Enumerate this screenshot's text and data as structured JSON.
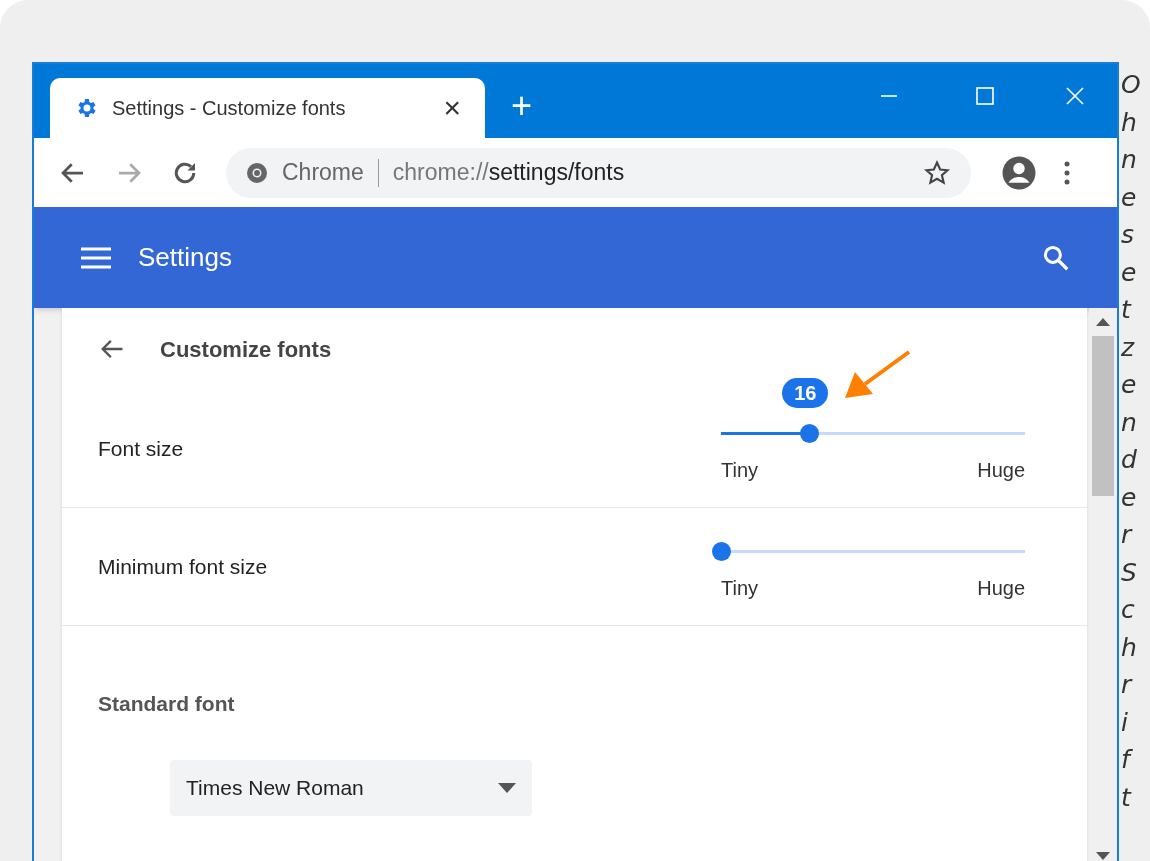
{
  "tab": {
    "title": "Settings - Customize fonts",
    "close": "×",
    "new_tab": "+"
  },
  "address_bar": {
    "origin": "Chrome",
    "url_scheme": "chrome://",
    "url_path": "settings/fonts"
  },
  "header": {
    "title": "Settings"
  },
  "page": {
    "title": "Customize fonts"
  },
  "sliders": [
    {
      "label": "Font size",
      "level": 0.29,
      "value_bubble": "16",
      "min_label": "Tiny",
      "max_label": "Huge"
    },
    {
      "label": "Minimum font size",
      "level": 0,
      "min_label": "Tiny",
      "max_label": "Huge"
    }
  ],
  "standard_font": {
    "heading": "Standard font",
    "dropdown": "Times New Roman"
  },
  "side_text": "OhnesetzenderSchrift"
}
